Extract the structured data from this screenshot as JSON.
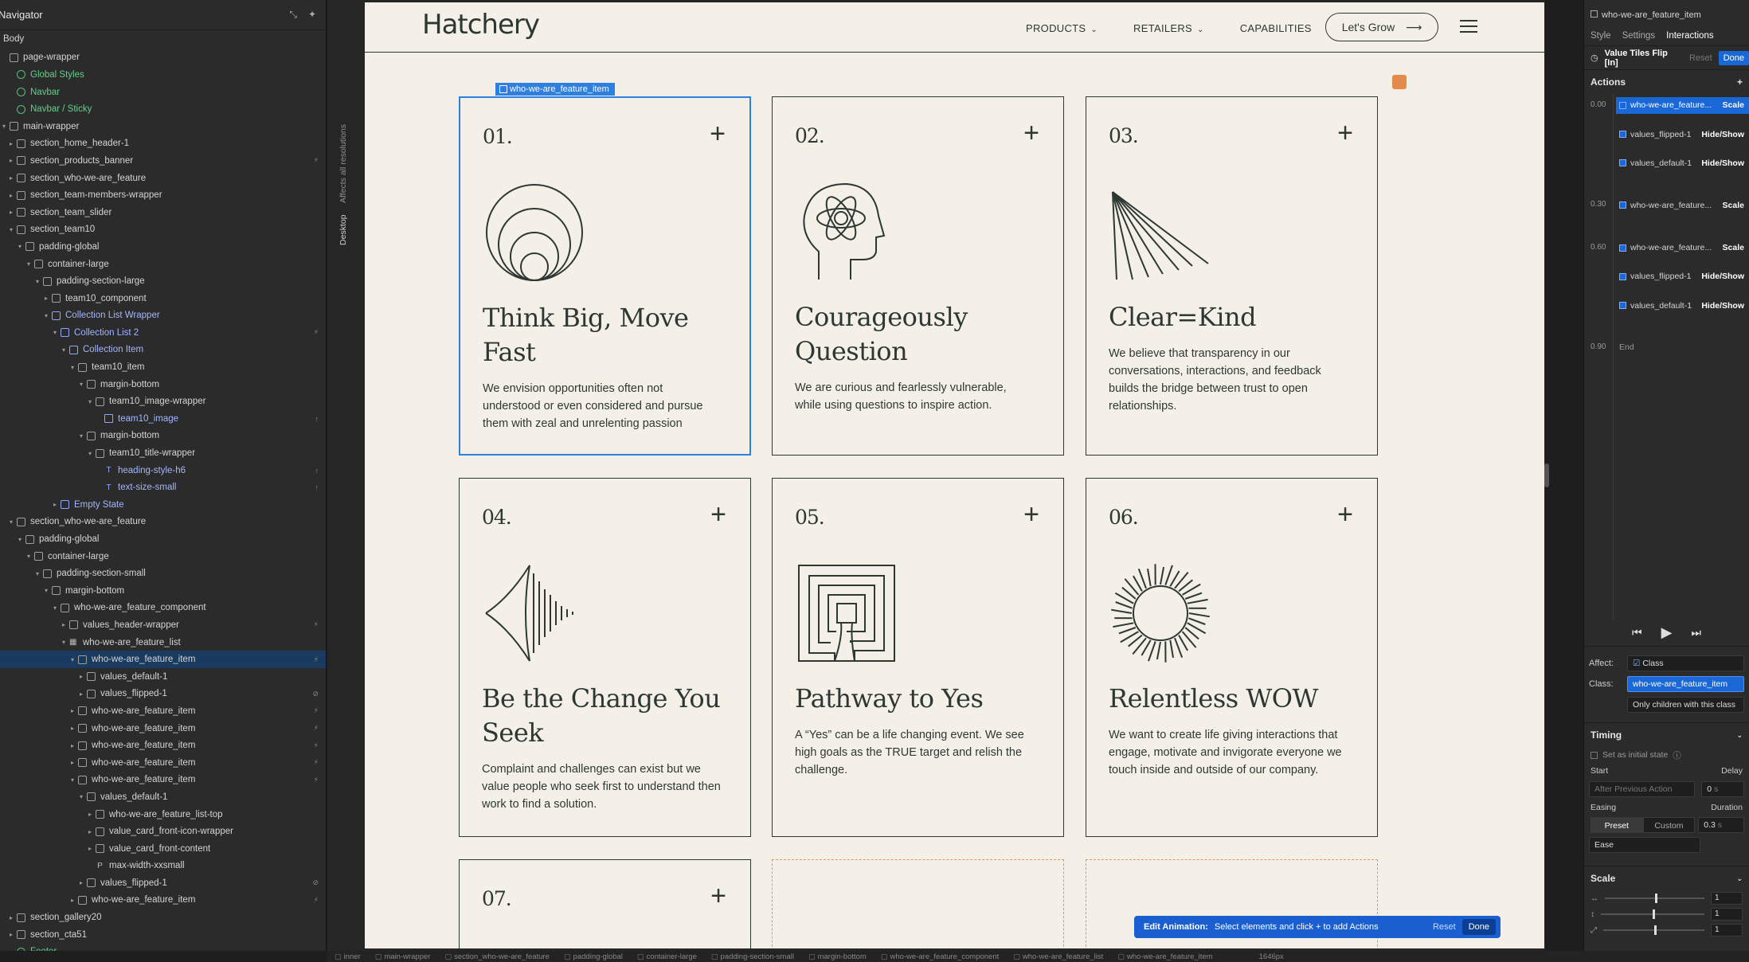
{
  "navigator": {
    "title": "Navigator",
    "body_label": "Body",
    "rows": [
      {
        "label": "page-wrapper",
        "depth": 0,
        "caret": "",
        "icon": "box"
      },
      {
        "label": "Global Styles",
        "depth": 1,
        "caret": "",
        "icon": "sym",
        "color": "green"
      },
      {
        "label": "Navbar",
        "depth": 1,
        "caret": "",
        "icon": "sym",
        "color": "green"
      },
      {
        "label": "Navbar / Sticky",
        "depth": 1,
        "caret": "",
        "icon": "sym",
        "color": "green"
      },
      {
        "label": "main-wrapper",
        "depth": 0,
        "caret": "v",
        "icon": "box"
      },
      {
        "label": "section_home_header-1",
        "depth": 1,
        "caret": ">",
        "icon": "box"
      },
      {
        "label": "section_products_banner",
        "depth": 1,
        "caret": ">",
        "icon": "box",
        "badge": "⚡"
      },
      {
        "label": "section_who-we-are_feature",
        "depth": 1,
        "caret": ">",
        "icon": "box"
      },
      {
        "label": "section_team-members-wrapper",
        "depth": 1,
        "caret": ">",
        "icon": "box"
      },
      {
        "label": "section_team_slider",
        "depth": 1,
        "caret": ">",
        "icon": "box"
      },
      {
        "label": "section_team10",
        "depth": 1,
        "caret": "v",
        "icon": "box"
      },
      {
        "label": "padding-global",
        "depth": 2,
        "caret": "v",
        "icon": "box"
      },
      {
        "label": "container-large",
        "depth": 3,
        "caret": "v",
        "icon": "box"
      },
      {
        "label": "padding-section-large",
        "depth": 4,
        "caret": "v",
        "icon": "box"
      },
      {
        "label": "team10_component",
        "depth": 5,
        "caret": ">",
        "icon": "box"
      },
      {
        "label": "Collection List Wrapper",
        "depth": 5,
        "caret": "v",
        "icon": "coll",
        "color": "blue"
      },
      {
        "label": "Collection List 2",
        "depth": 6,
        "caret": "v",
        "icon": "coll",
        "color": "blue",
        "badge": "⚡"
      },
      {
        "label": "Collection Item",
        "depth": 7,
        "caret": "v",
        "icon": "coll",
        "color": "blue"
      },
      {
        "label": "team10_item",
        "depth": 8,
        "caret": "v",
        "icon": "box"
      },
      {
        "label": "margin-bottom",
        "depth": 9,
        "caret": "v",
        "icon": "box"
      },
      {
        "label": "team10_image-wrapper",
        "depth": 10,
        "caret": "v",
        "icon": "box"
      },
      {
        "label": "team10_image",
        "depth": 11,
        "caret": "",
        "icon": "img",
        "color": "blue",
        "badge": "↑"
      },
      {
        "label": "margin-bottom",
        "depth": 9,
        "caret": "v",
        "icon": "box"
      },
      {
        "label": "team10_title-wrapper",
        "depth": 10,
        "caret": "v",
        "icon": "box"
      },
      {
        "label": "heading-style-h6",
        "depth": 11,
        "caret": "",
        "icon": "txt",
        "color": "blue",
        "badge": "↑"
      },
      {
        "label": "text-size-small",
        "depth": 11,
        "caret": "",
        "icon": "txt",
        "color": "blue",
        "badge": "↑"
      },
      {
        "label": "Empty State",
        "depth": 6,
        "caret": ">",
        "icon": "coll",
        "color": "blue"
      },
      {
        "label": "section_who-we-are_feature",
        "depth": 1,
        "caret": "v",
        "icon": "box"
      },
      {
        "label": "padding-global",
        "depth": 2,
        "caret": "v",
        "icon": "box"
      },
      {
        "label": "container-large",
        "depth": 3,
        "caret": "v",
        "icon": "box"
      },
      {
        "label": "padding-section-small",
        "depth": 4,
        "caret": "v",
        "icon": "box"
      },
      {
        "label": "margin-bottom",
        "depth": 5,
        "caret": "v",
        "icon": "box"
      },
      {
        "label": "who-we-are_feature_component",
        "depth": 6,
        "caret": "v",
        "icon": "box"
      },
      {
        "label": "values_header-wrapper",
        "depth": 7,
        "caret": ">",
        "icon": "box",
        "badge": "⚡"
      },
      {
        "label": "who-we-are_feature_list",
        "depth": 7,
        "caret": "v",
        "icon": "grid"
      },
      {
        "label": "who-we-are_feature_item",
        "depth": 8,
        "caret": "v",
        "icon": "box",
        "selected": true,
        "badge": "⚡"
      },
      {
        "label": "values_default-1",
        "depth": 9,
        "caret": ">",
        "icon": "box"
      },
      {
        "label": "values_flipped-1",
        "depth": 9,
        "caret": ">",
        "icon": "box",
        "badge": "⊘"
      },
      {
        "label": "who-we-are_feature_item",
        "depth": 8,
        "caret": ">",
        "icon": "box",
        "badge": "⚡"
      },
      {
        "label": "who-we-are_feature_item",
        "depth": 8,
        "caret": ">",
        "icon": "box",
        "badge": "⚡"
      },
      {
        "label": "who-we-are_feature_item",
        "depth": 8,
        "caret": ">",
        "icon": "box",
        "badge": "⚡"
      },
      {
        "label": "who-we-are_feature_item",
        "depth": 8,
        "caret": ">",
        "icon": "box",
        "badge": "⚡"
      },
      {
        "label": "who-we-are_feature_item",
        "depth": 8,
        "caret": "v",
        "icon": "box",
        "badge": "⚡"
      },
      {
        "label": "values_default-1",
        "depth": 9,
        "caret": "v",
        "icon": "box"
      },
      {
        "label": "who-we-are_feature_list-top",
        "depth": 10,
        "caret": ">",
        "icon": "box"
      },
      {
        "label": "value_card_front-icon-wrapper",
        "depth": 10,
        "caret": ">",
        "icon": "box"
      },
      {
        "label": "value_card_front-content",
        "depth": 10,
        "caret": ">",
        "icon": "box"
      },
      {
        "label": "max-width-xxsmall",
        "depth": 10,
        "caret": "",
        "icon": "para"
      },
      {
        "label": "values_flipped-1",
        "depth": 9,
        "caret": ">",
        "icon": "box",
        "badge": "⊘"
      },
      {
        "label": "who-we-are_feature_item",
        "depth": 8,
        "caret": ">",
        "icon": "box",
        "badge": "⚡"
      },
      {
        "label": "section_gallery20",
        "depth": 1,
        "caret": ">",
        "icon": "box"
      },
      {
        "label": "section_cta51",
        "depth": 1,
        "caret": ">",
        "icon": "box"
      },
      {
        "label": "Footer",
        "depth": 1,
        "caret": "",
        "icon": "sym",
        "color": "green"
      }
    ]
  },
  "vtabs": {
    "affects": "Affects all resolutions",
    "desktop": "Desktop"
  },
  "site": {
    "logo": "Hatchery",
    "nav": {
      "products": "PRODUCTS",
      "retailers": "RETAILERS",
      "capabilities": "CAPABILITIES"
    },
    "cta": "Let's Grow",
    "selected_tag": "who-we-are_feature_item",
    "cards": [
      {
        "num": "01.",
        "title": "Think Big, Move Fast",
        "desc": "We envision opportunities often not understood or even considered and pursue them with zeal and unrelenting passion",
        "icon": "circles-icon",
        "selected": true
      },
      {
        "num": "02.",
        "title": "Courageously Question",
        "desc": "We are curious and fearlessly vulnerable, while using questions to inspire action.",
        "icon": "head-atom-icon"
      },
      {
        "num": "03.",
        "title": "Clear=Kind",
        "desc": "We believe that transparency in our conversations, interactions, and feedback builds the bridge between trust to open relationships.",
        "icon": "rays-icon"
      },
      {
        "num": "04.",
        "title": "Be the Change You Seek",
        "desc": "Complaint and challenges can exist but we value people who seek first to understand then work to find a solution.",
        "icon": "sound-wave-icon"
      },
      {
        "num": "05.",
        "title": "Pathway to Yes",
        "desc": "A “Yes” can be a life changing event. We see high goals as the TRUE target and relish the challenge.",
        "icon": "maze-icon"
      },
      {
        "num": "06.",
        "title": "Relentless WOW",
        "desc": "We want to create life giving interactions that engage, motivate and invigorate everyone we touch inside and outside of our company.",
        "icon": "burst-icon"
      },
      {
        "num": "07.",
        "title": "",
        "desc": "",
        "icon": ""
      }
    ],
    "edit_bar": {
      "label": "Edit Animation:",
      "hint": "Select elements and click + to add Actions",
      "reset": "Reset",
      "done": "Done"
    }
  },
  "panel": {
    "element": "who-we-are_feature_item",
    "tabs": [
      "Style",
      "Settings",
      "Interactions"
    ],
    "active_tab": "Interactions",
    "animation": {
      "name": "Value Tiles Flip [In]",
      "reset": "Reset",
      "done": "Done"
    },
    "actions_label": "Actions",
    "actions": [
      {
        "time": "0.00",
        "target": "who-we-are_feature...",
        "action": "Scale",
        "hl": true
      },
      {
        "time": "",
        "target": "values_flipped-1",
        "action": "Hide/Show"
      },
      {
        "time": "",
        "target": "values_default-1",
        "action": "Hide/Show"
      },
      {
        "time": "0.30",
        "target": "who-we-are_feature...",
        "action": "Scale"
      },
      {
        "time": "0.60",
        "target": "who-we-are_feature...",
        "action": "Scale"
      },
      {
        "time": "",
        "target": "values_flipped-1",
        "action": "Hide/Show"
      },
      {
        "time": "",
        "target": "values_default-1",
        "action": "Hide/Show"
      },
      {
        "time": "0.90",
        "target": "End",
        "action": ""
      }
    ],
    "affect": {
      "label": "Affect:",
      "value": "Class"
    },
    "class": {
      "label": "Class:",
      "value": "who-we-are_feature_item",
      "scope": "Only children with this class"
    },
    "timing": {
      "label": "Timing",
      "initial_state": "Set as initial state",
      "start_label": "Start",
      "start_value": "After Previous Action",
      "delay_label": "Delay",
      "delay_value": "0",
      "delay_unit": "s",
      "easing_label": "Easing",
      "preset": "Preset",
      "custom": "Custom",
      "ease": "Ease",
      "duration_label": "Duration",
      "duration_value": "0.3",
      "duration_unit": "s"
    },
    "scale": {
      "label": "Scale",
      "values": [
        "1",
        "1",
        "1"
      ]
    }
  },
  "breadcrumbs": [
    "inner",
    "main-wrapper",
    "section_who-we-are_feature",
    "padding-global",
    "container-large",
    "padding-section-small",
    "margin-bottom",
    "who-we-are_feature_component",
    "who-we-are_feature_list",
    "who-we-are_feature_item",
    "1646px"
  ]
}
